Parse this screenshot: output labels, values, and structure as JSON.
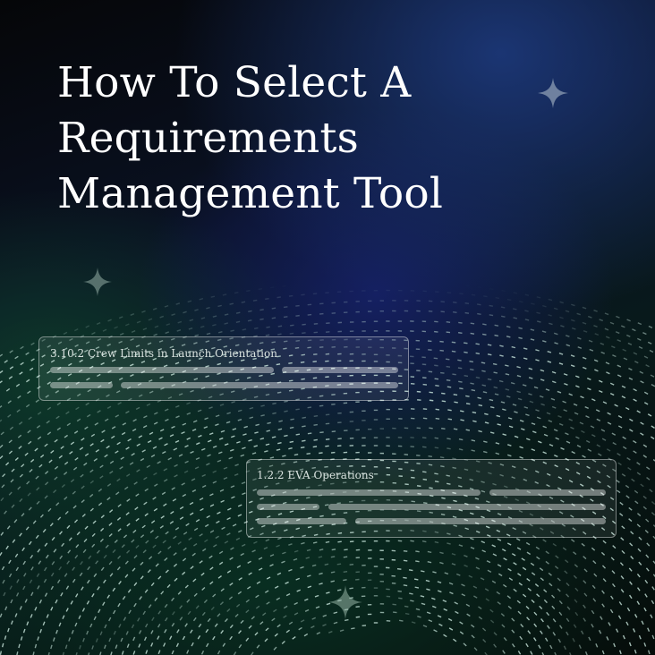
{
  "headline": {
    "lines": [
      "How To Select A",
      "Requirements",
      "Management Tool"
    ]
  },
  "cards": [
    {
      "title": "3.10.2 Crew Limits in Launch Orientation"
    },
    {
      "title": "1.2.2 EVA Operations"
    }
  ],
  "icons": [
    "sparkle-icon"
  ],
  "colors": {
    "accent_green": "#1e5a3c",
    "accent_blue": "#1e3c82",
    "text": "#ffffff"
  }
}
